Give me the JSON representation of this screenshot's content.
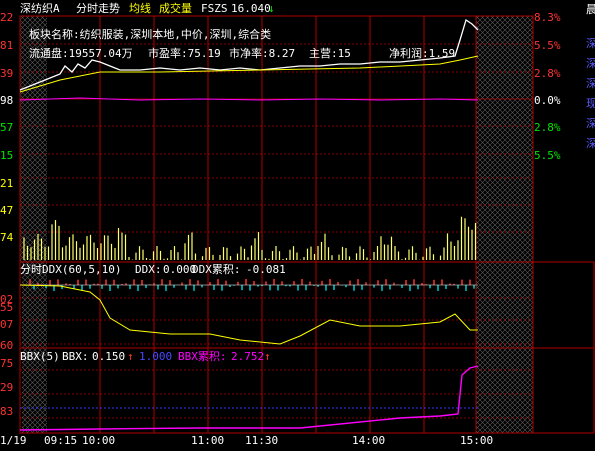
{
  "header": {
    "stock_name": "深纺织A",
    "tab_intraday": "分时走势",
    "tab_avg": "均线",
    "tab_volume": "成交量",
    "ticker_label": "FSZS",
    "price": "16.040",
    "price_arrow": "↓"
  },
  "info": {
    "line1": "板块名称:纺织服装,深圳本地,中价,深圳,综合类",
    "line2_a": "流通盘:19557.04万",
    "line2_b": "市盈率:75.19",
    "line2_c": "市净率:8.27",
    "line2_d": "主营:15",
    "line2_e": "净利润:1.59"
  },
  "price_axis_left": [
    "22",
    "81",
    "39",
    "98",
    "57",
    "15",
    "21",
    "47",
    "74"
  ],
  "price_axis_right": [
    "8.3%",
    "5.5%",
    "2.8%",
    "0.0%",
    "2.8%",
    "5.5%"
  ],
  "ddx_panel": {
    "title": "分时DDX(60,5,10)",
    "ddx_label": "DDX:",
    "ddx_value": "0.000",
    "ddx_cum_label": "DDX累积:",
    "ddx_cum_value": "-0.081",
    "axis_left": [
      "02",
      "55",
      "07",
      "60"
    ]
  },
  "bbx_panel": {
    "title": "BBX(5)",
    "bbx_label": "BBX:",
    "bbx_value": "0.150",
    "bbx_arrow": "↑",
    "ref_value": "1.000",
    "bbx_cum_label": "BBX累积:",
    "bbx_cum_value": "2.752",
    "cum_arrow": "↑",
    "axis_left": [
      "75",
      "29",
      "83"
    ]
  },
  "time_axis": [
    "1/19",
    "09:15",
    "10:00",
    "11:00",
    "11:30",
    "14:00",
    "15:00"
  ],
  "right_side_labels": [
    "晨",
    "深",
    "深",
    "深",
    "现",
    "深",
    "深"
  ],
  "colors": {
    "grid": "#b00000",
    "up": "#ff3232",
    "down": "#00e600",
    "price_line": "#ffffff",
    "avg_line": "#ffff00",
    "ddx_cum": "#ffff00",
    "bbx": "#ff00ff",
    "ref_line": "#3333ff",
    "volume": "#ffff66"
  }
}
